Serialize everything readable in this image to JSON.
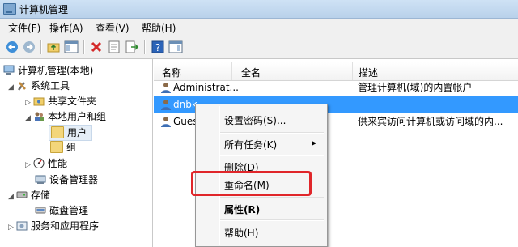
{
  "window": {
    "title": "计算机管理"
  },
  "menubar": {
    "items": [
      "文件(F)",
      "操作(A)",
      "查看(V)",
      "帮助(H)"
    ]
  },
  "tree": {
    "items": [
      {
        "label": "计算机管理(本地)"
      },
      {
        "label": "系统工具"
      },
      {
        "label": "共享文件夹"
      },
      {
        "label": "本地用户和组"
      },
      {
        "label": "用户"
      },
      {
        "label": "组"
      },
      {
        "label": "性能"
      },
      {
        "label": "设备管理器"
      },
      {
        "label": "存储"
      },
      {
        "label": "磁盘管理"
      },
      {
        "label": "服务和应用程序"
      }
    ]
  },
  "list": {
    "columns": [
      "名称",
      "全名",
      "描述"
    ],
    "rows": [
      {
        "name": "Administrat...",
        "fullname": "",
        "description": "管理计算机(域)的内置帐户"
      },
      {
        "name": "dnbk",
        "fullname": "",
        "description": ""
      },
      {
        "name": "Guest",
        "fullname": "",
        "description": "供来宾访问计算机或访问域的内..."
      }
    ]
  },
  "context_menu": {
    "items": [
      "设置密码(S)...",
      "所有任务(K)",
      "删除(D)",
      "重命名(M)",
      "属性(R)",
      "帮助(H)"
    ],
    "highlighted": "重命名(M)"
  },
  "colors": {
    "selection": "#3399ff",
    "highlight_box": "#e0262a"
  }
}
